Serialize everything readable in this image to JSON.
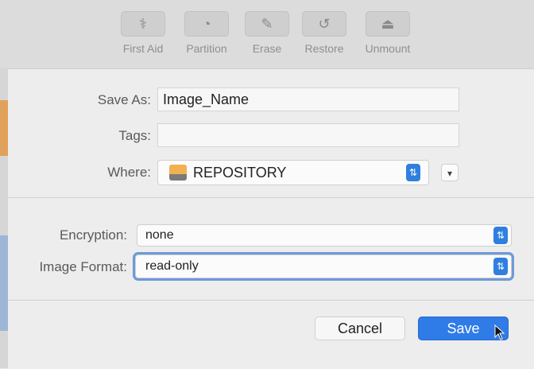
{
  "toolbar": {
    "items": [
      {
        "label": "First Aid",
        "icon": "stethoscope-icon",
        "glyph": "⚕"
      },
      {
        "label": "Partition",
        "icon": "pie-chart-icon",
        "glyph": "◔"
      },
      {
        "label": "Erase",
        "icon": "pen-icon",
        "glyph": "✎"
      },
      {
        "label": "Restore",
        "icon": "restore-icon",
        "glyph": "↺"
      },
      {
        "label": "Unmount",
        "icon": "eject-icon",
        "glyph": "⏏"
      }
    ]
  },
  "form": {
    "save_as_label": "Save As:",
    "save_as_value": "Image_Name",
    "tags_label": "Tags:",
    "tags_value": "",
    "where_label": "Where:",
    "where_value": "REPOSITORY",
    "encryption_label": "Encryption:",
    "encryption_value": "none",
    "image_format_label": "Image Format:",
    "image_format_value": "read-only"
  },
  "buttons": {
    "cancel_label": "Cancel",
    "save_label": "Save"
  },
  "colors": {
    "accent": "#2f7be8",
    "drive_orange": "#f2b050"
  }
}
